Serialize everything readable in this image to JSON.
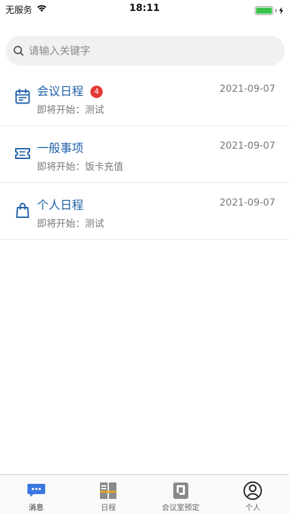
{
  "status_bar": {
    "carrier": "无服务",
    "time": "18:11"
  },
  "search": {
    "placeholder": "请输入关键字"
  },
  "messages": [
    {
      "icon": "calendar-icon",
      "title": "会议日程",
      "badge": "4",
      "subtitle": "即将开始：测试",
      "date": "2021-09-07"
    },
    {
      "icon": "ticket-icon",
      "title": "一般事项",
      "subtitle": "即将开始：饭卡充值",
      "date": "2021-09-07"
    },
    {
      "icon": "bag-icon",
      "title": "个人日程",
      "subtitle": "即将开始：测试",
      "date": "2021-09-07"
    }
  ],
  "tabbar": {
    "items": [
      {
        "label": "消息",
        "icon": "chat-bubble-icon",
        "active": true
      },
      {
        "label": "日程",
        "icon": "schedule-icon",
        "active": false
      },
      {
        "label": "会议室预定",
        "icon": "room-booking-icon",
        "active": false
      },
      {
        "label": "个人",
        "icon": "person-icon",
        "active": false
      }
    ]
  },
  "colors": {
    "accent": "#1f5fa8",
    "badge": "#e53935",
    "battery": "#3ac34a",
    "active_tab": "#3a78e0"
  }
}
